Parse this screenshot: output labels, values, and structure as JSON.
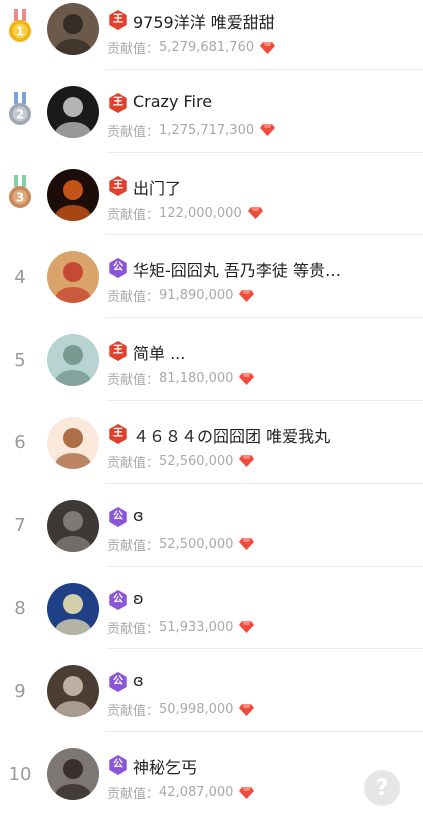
{
  "contrib_label": "贡献值：",
  "rows": [
    {
      "rank": "1",
      "badge": "王",
      "badge_type": "king",
      "name": "9759洋洋 唯爱甜甜",
      "value": "5,279,681,760",
      "avatar_color": "#6b5a4a",
      "avatar_accent": "#2d2620"
    },
    {
      "rank": "2",
      "badge": "王",
      "badge_type": "king",
      "name": "Crazy Fire",
      "value": "1,275,717,300",
      "avatar_color": "#1a1a1a",
      "avatar_accent": "#cfcfcf"
    },
    {
      "rank": "3",
      "badge": "王",
      "badge_type": "king",
      "name": "出门了",
      "value": "122,000,000",
      "avatar_color": "#1d0d08",
      "avatar_accent": "#e0601a"
    },
    {
      "rank": "4",
      "badge": "公",
      "badge_type": "duke",
      "name": "华矩-囧囧丸 吾乃李徒 等贵…",
      "value": "91,890,000",
      "avatar_color": "#d9a36a",
      "avatar_accent": "#c23a2a"
    },
    {
      "rank": "5",
      "badge": "王",
      "badge_type": "king",
      "name": "简单 ...",
      "value": "81,180,000",
      "avatar_color": "#b7d4d2",
      "avatar_accent": "#6f8f86"
    },
    {
      "rank": "6",
      "badge": "王",
      "badge_type": "king",
      "name": "４６８４の囧囧团 唯爱我丸",
      "value": "52,560,000",
      "avatar_color": "#fbe9dc",
      "avatar_accent": "#a0592d"
    },
    {
      "rank": "7",
      "badge": "公",
      "badge_type": "duke",
      "name": "ɞ",
      "value": "52,500,000",
      "avatar_color": "#3c3836",
      "avatar_accent": "#8a8580"
    },
    {
      "rank": "8",
      "badge": "公",
      "badge_type": "duke",
      "name": "ʚ",
      "value": "51,933,000",
      "avatar_color": "#1f3f86",
      "avatar_accent": "#f3e7b3"
    },
    {
      "rank": "9",
      "badge": "公",
      "badge_type": "duke",
      "name": "ɞ",
      "value": "50,998,000",
      "avatar_color": "#4b3d33",
      "avatar_accent": "#cfc4b5"
    },
    {
      "rank": "10",
      "badge": "公",
      "badge_type": "duke",
      "name": "神秘乞丐",
      "value": "42,087,000",
      "avatar_color": "#7d7773",
      "avatar_accent": "#2b2321"
    }
  ],
  "help_label": "?",
  "colors": {
    "king_badge": "#e0402c",
    "duke_badge": "#8a55d6",
    "gem": "#f04a3a",
    "gold": "#f2b315",
    "silver": "#9fa7b3",
    "bronze": "#c78a5a"
  }
}
